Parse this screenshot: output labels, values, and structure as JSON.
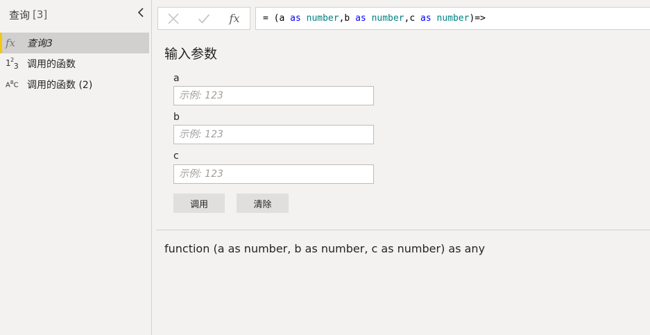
{
  "queries_pane": {
    "title": "查询",
    "count": "[3]",
    "items": [
      {
        "label": "查询3",
        "icon": "fx-icon",
        "selected": true
      },
      {
        "label": "调用的函数",
        "icon": "number-type-icon",
        "selected": false
      },
      {
        "label": "调用的函数 (2)",
        "icon": "text-type-icon",
        "selected": false
      }
    ]
  },
  "formula_bar": {
    "cancel_icon": "close-icon",
    "commit_icon": "check-icon",
    "fx_label": "fx",
    "tokens": [
      {
        "text": "= (a ",
        "kind": "op"
      },
      {
        "text": "as",
        "kind": "kw"
      },
      {
        "text": " ",
        "kind": "op"
      },
      {
        "text": "number",
        "kind": "type"
      },
      {
        "text": ",b ",
        "kind": "op"
      },
      {
        "text": "as",
        "kind": "kw"
      },
      {
        "text": " ",
        "kind": "op"
      },
      {
        "text": "number",
        "kind": "type"
      },
      {
        "text": ",c ",
        "kind": "op"
      },
      {
        "text": "as",
        "kind": "kw"
      },
      {
        "text": " ",
        "kind": "op"
      },
      {
        "text": "number",
        "kind": "type"
      },
      {
        "text": ")=>",
        "kind": "op"
      }
    ]
  },
  "main": {
    "title": "输入参数",
    "params": [
      {
        "label": "a",
        "placeholder": "示例: 123",
        "value": ""
      },
      {
        "label": "b",
        "placeholder": "示例: 123",
        "value": ""
      },
      {
        "label": "c",
        "placeholder": "示例: 123",
        "value": ""
      }
    ],
    "invoke_label": "调用",
    "clear_label": "清除",
    "signature": "function (a as number, b as number, c as number) as any"
  },
  "colors": {
    "background": "#f3f2f1",
    "selected_item": "#d2d0ce",
    "selected_accent": "#f2c811",
    "keyword": "#0000ff",
    "type": "#008080",
    "button_bg": "#e1dfdd"
  }
}
